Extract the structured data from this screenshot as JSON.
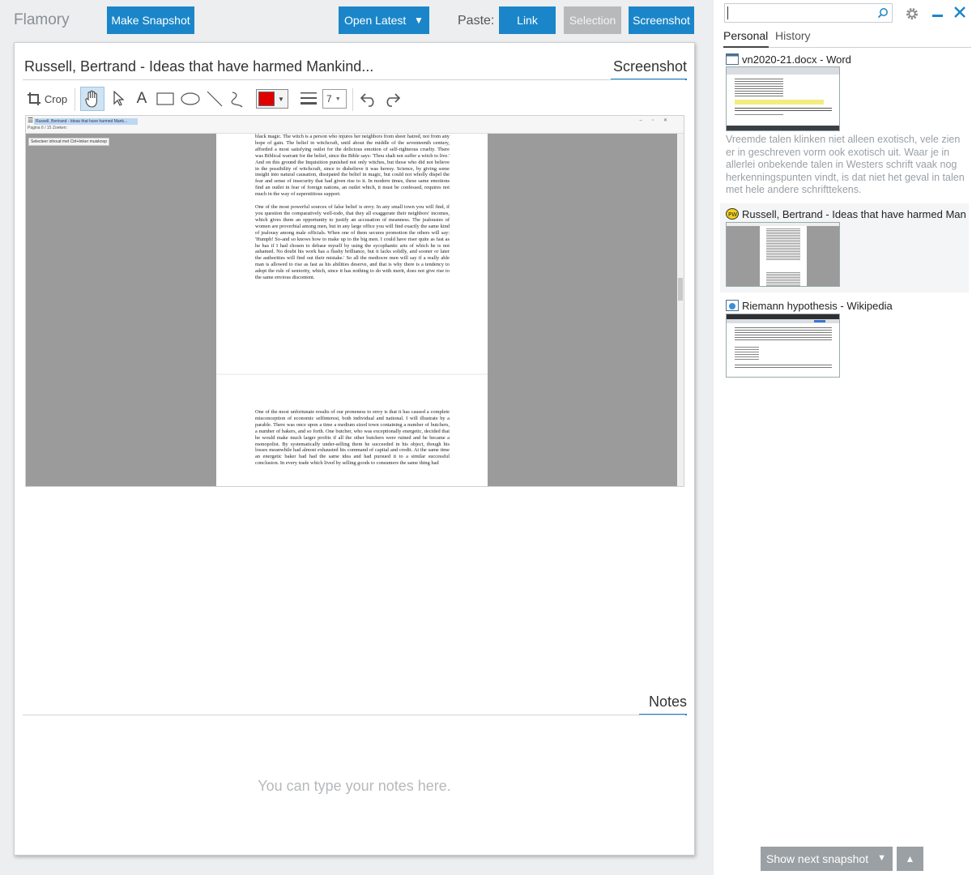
{
  "app": {
    "title": "Flamory"
  },
  "toolbar": {
    "make_snapshot": "Make Snapshot",
    "open_latest": "Open Latest",
    "paste_label": "Paste:",
    "link": "Link",
    "selection": "Selection",
    "screenshot": "Screenshot"
  },
  "card": {
    "title": "Russell, Bertrand - Ideas that have harmed Mankind...",
    "screenshot_tab": "Screenshot",
    "notes_tab": "Notes",
    "notes_placeholder": "You can type your notes here."
  },
  "editor_tools": {
    "crop": "Crop",
    "line_width": "7",
    "color": "#e00000"
  },
  "screenshot_image": {
    "tab_title": "Russell, Bertrand - Ideas that have harmed Mank...",
    "pdf_toolbar": "Pagina   6 / 15         Zoeken:",
    "hint": "Selecteer inhoud met Ctrl+linker muisknop",
    "page1_paragraphs": [
      "black magic. The witch is a person who injures her neighbors from sheer hatred, not from any hope of gain. The belief in witchcraft, until about the middle of the seventeenth century, afforded a most satisfying outlet for the delicious emotion of self-righteous cruelty. There was Biblical warrant for the belief, since the Bible says: 'Thou shalt not suffer a witch to live.' And on this ground the Inquisition punished not only witches, but those who did not believe in the possibility of witchcraft, since to disbelieve it was heresy. Science, by giving some insight into natural causation, dissipated the belief in magic, but could not wholly dispel the fear and sense of insecurity that had given rise to it. In modern times, these same emotions find an outlet in fear of foreign nations, an outlet which, it must be confessed, requires not much in the way of superstitious support.",
      "One of the most powerful sources of false belief is envy. In any small town you will find, if you question the comparatively well-todo, that they all exaggerate their neighbors' incomes, which gives them an opportunity to justify an accusation of meanness. The jealousies of women are proverbial among men, but in any large office you will find exactly the same kind of jealousy among male officials. When one of them secures promotion the others will say: 'Humph! So-and so knows how to make up to the big men. I could have riser quite as fast as he has if I had chosen to debase myself by using the sycophantic arts of which he is not ashamed. No doubt his work has a flashy brilliance, but it lacks solidly, and sooner or later the authorities will find out their mistake.' So all the mediocre men will say if a really able man is allowed to rise as fast as his abilities deserve, and that is why there is a tendency to adopt the rule of seniority, which, since it has nothing to do with merit, does not give rise to the same envious discontent."
    ],
    "page2_paragraphs": [
      "One of the most unfortunate results of our proneness to envy is that it has caused a complete misconception of economic selfinterest, both individual and national. I will illustrate by a parable. There was once upon a time a medium sized town containing a number of butchers, a number of bakers, and so forth. One butcher, who was exceptionally energetic, decided that he would make much larger profits if all the other butchers were ruined and he became a monopolist. By systematically under-selling them he succeeded in his object, though his losses meanwhile had almost exhausted his command of capital and credit. At the same time an energetic baker had had the same idea and had pursued it to a similar successful conclusion. In every trade which lived by selling goods to consumers the same thing had"
    ]
  },
  "sidebar": {
    "search_placeholder": "",
    "tabs": [
      "Personal",
      "History"
    ],
    "items": [
      {
        "title": "vn2020-21.docx - Word",
        "description": "Vreemde talen klinken niet alleen exotisch, vele zien er in geschreven vorm ook exotisch uit. Waar je in allerlei onbekende talen in Westers schrift vaak nog herkenningspunten vindt, is dat niet het geval in talen met hele andere schrifttekens."
      },
      {
        "title": "Russell, Bertrand - Ideas that have harmed Man"
      },
      {
        "title": "Riemann hypothesis - Wikipedia"
      }
    ],
    "show_next": "Show next snapshot"
  }
}
